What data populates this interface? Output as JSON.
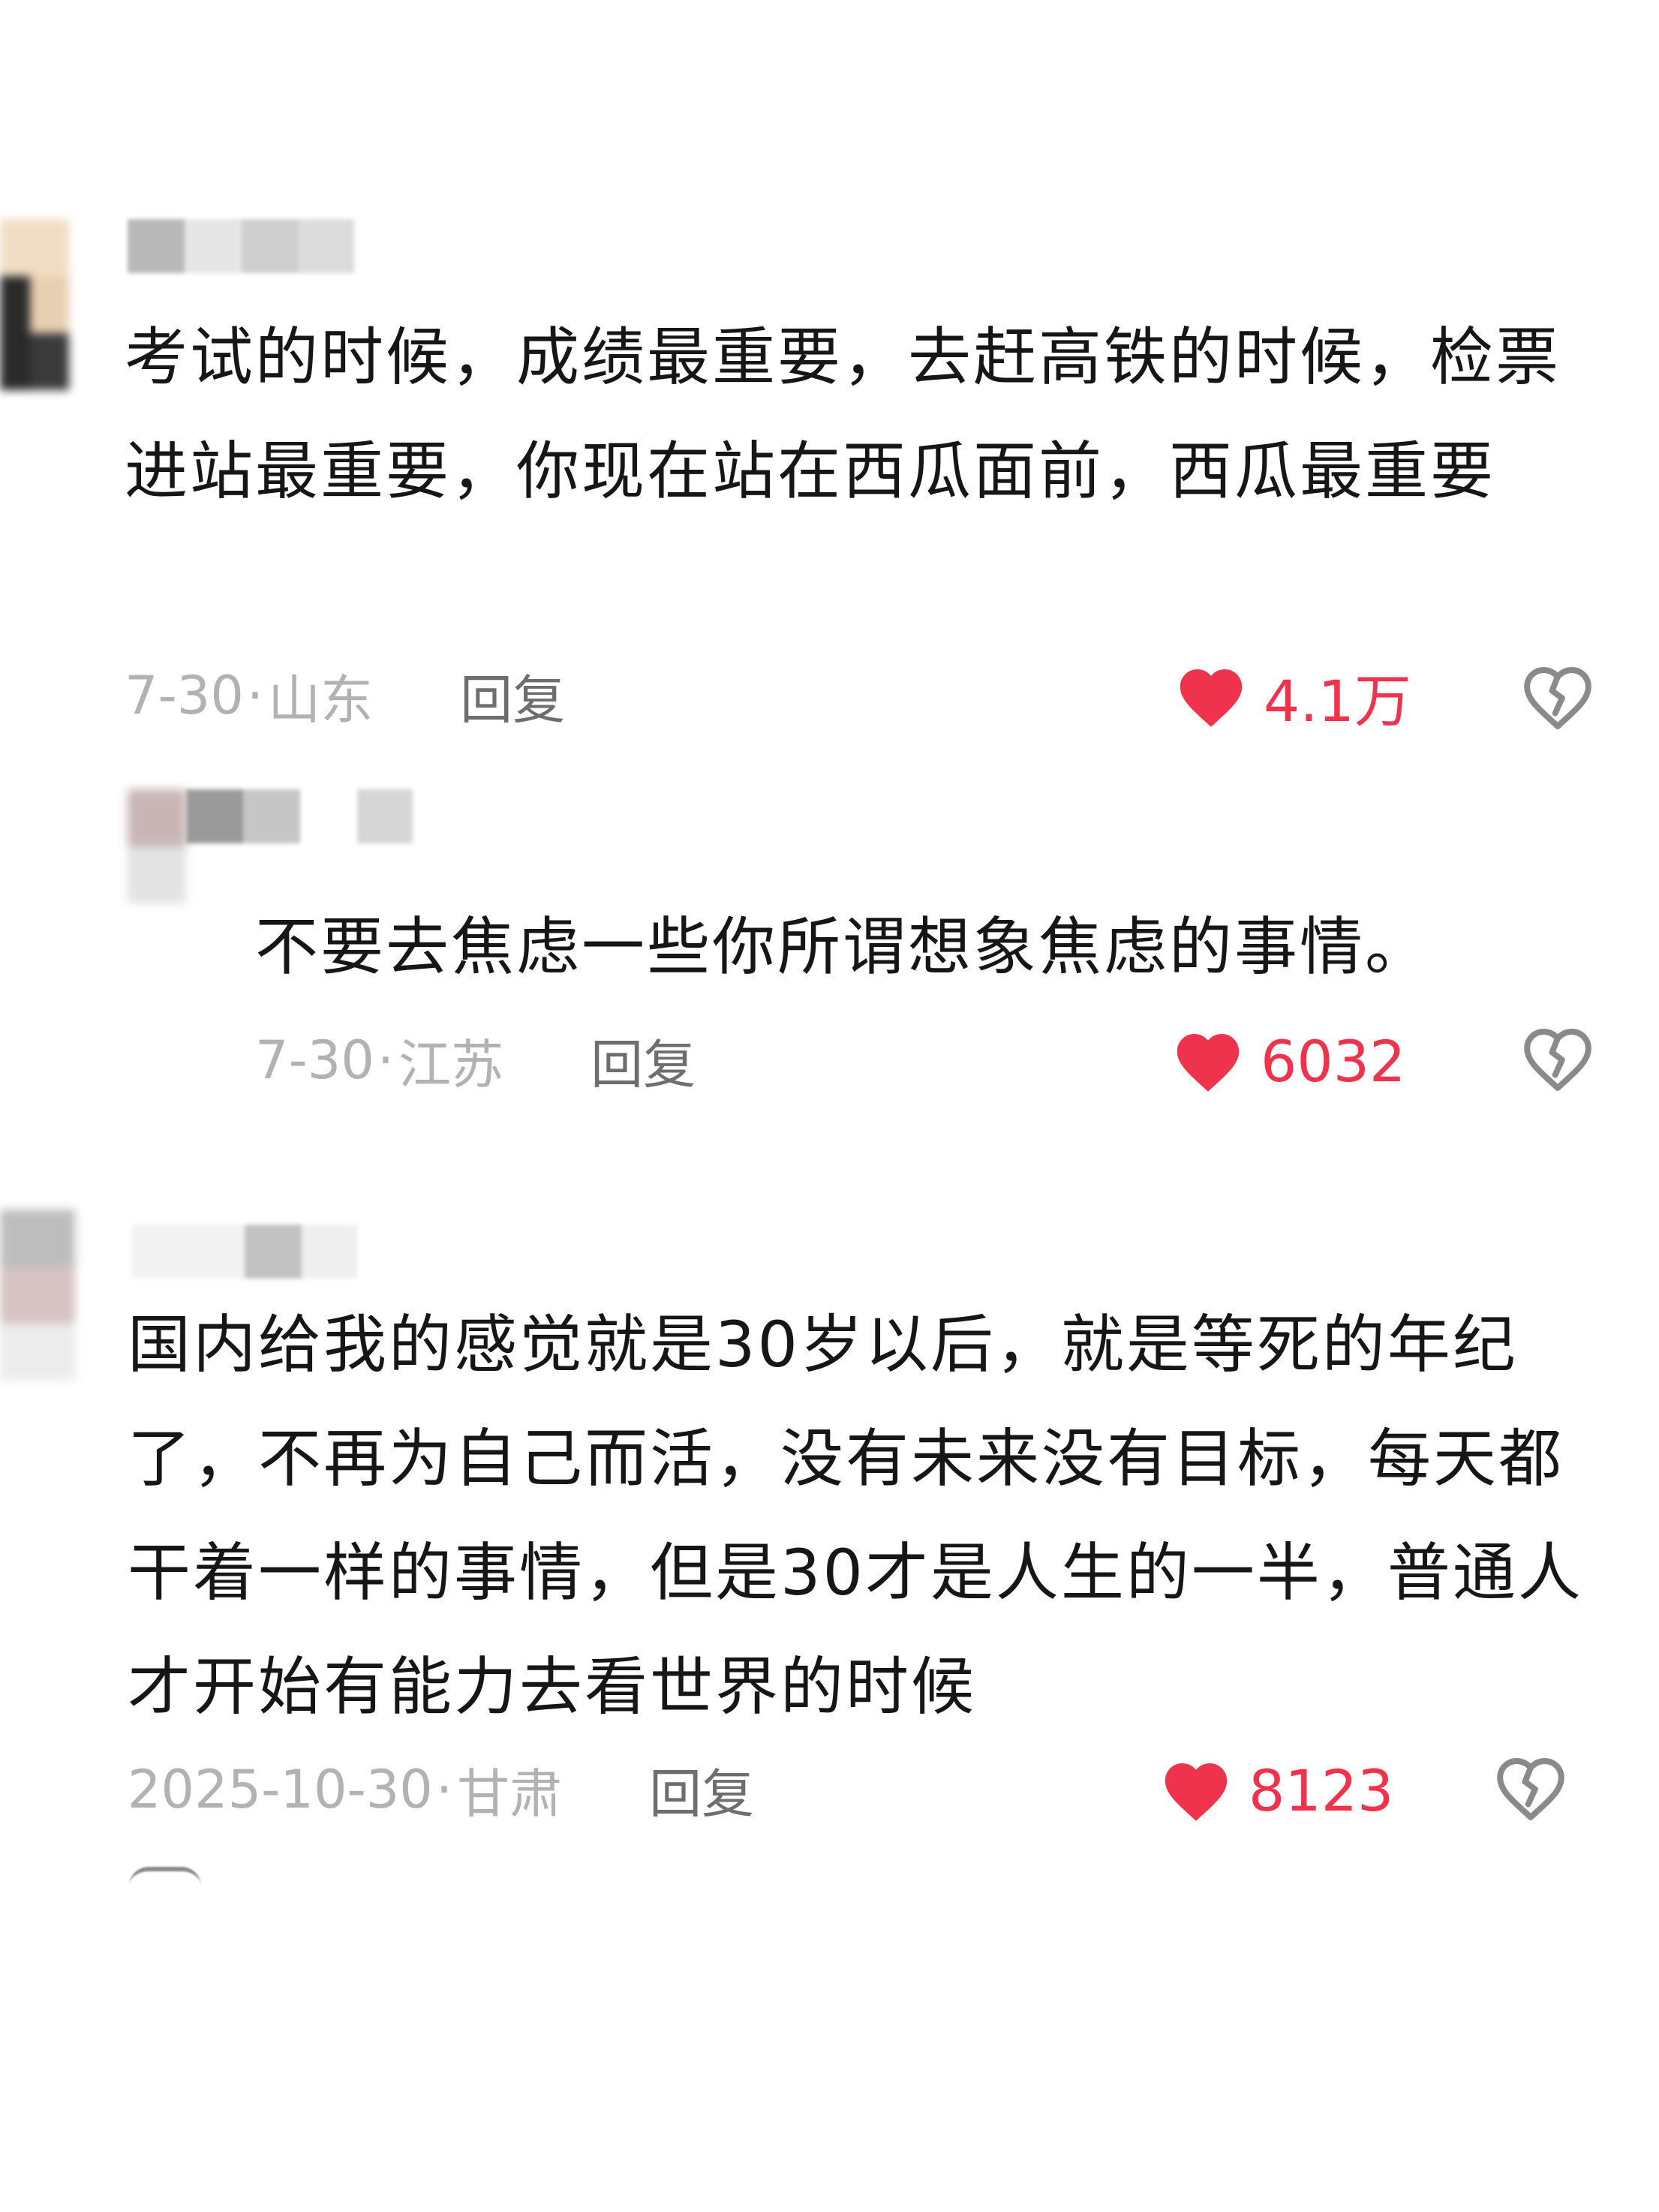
{
  "comments": [
    {
      "text": "考试的时候，成绩最重要，去赶高铁的时候，检票进站最重要，你现在站在西瓜面前，西瓜最重要",
      "date": "7-30",
      "separator": "·",
      "region": "山东",
      "reply_label": "回复",
      "likes": "4.1万"
    },
    {
      "text": "不要去焦虑一些你所谓想象焦虑的事情。",
      "date": "7-30",
      "separator": "·",
      "region": "江苏",
      "reply_label": "回复",
      "likes": "6032"
    },
    {
      "text": "国内给我的感觉就是30岁以后，就是等死的年纪了，不再为自己而活，没有未来没有目标，每天都干着一样的事情，但是30才是人生的一半，普通人才开始有能力去看世界的时候",
      "date": "2025-10-30",
      "separator": "·",
      "region": "甘肃",
      "reply_label": "回复",
      "likes": "8123"
    }
  ],
  "colors": {
    "like_red": "#f0334c",
    "meta_gray": "#b2b2b2",
    "reply_gray": "#6e6e6e",
    "text_dark": "#161616"
  },
  "icons": {
    "like": "heart-icon",
    "dislike": "broken-heart-icon"
  }
}
